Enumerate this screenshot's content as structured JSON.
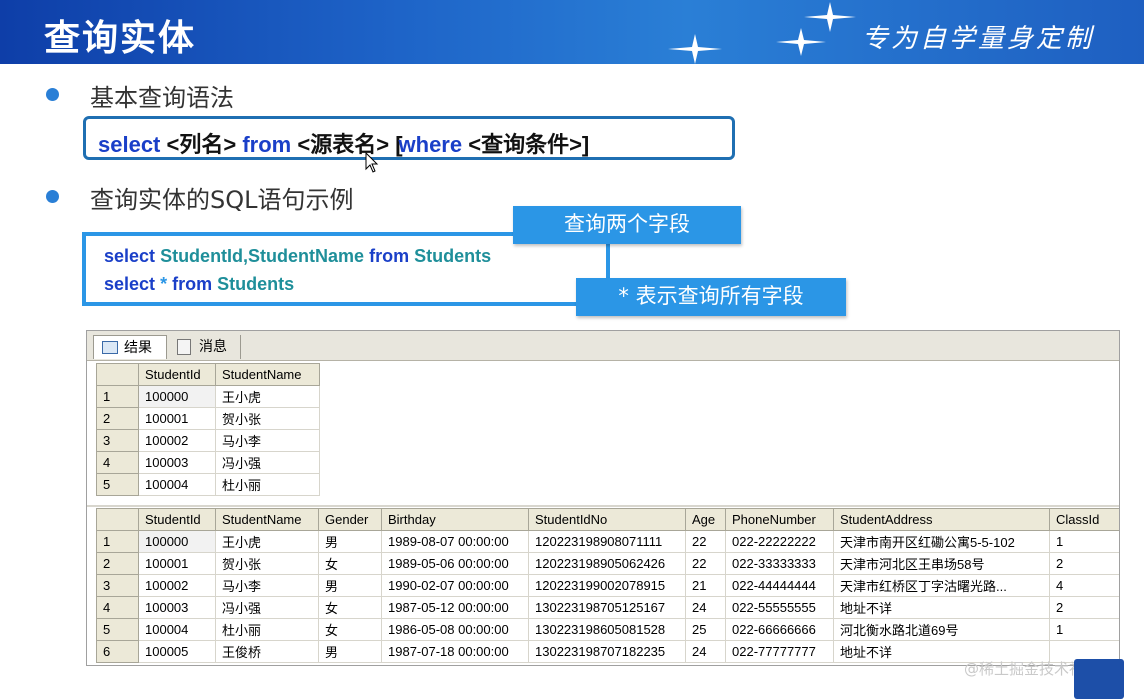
{
  "header": {
    "title": "查询实体",
    "slogan": "专为自学量身定制"
  },
  "bullets": [
    {
      "text": "基本查询语法"
    },
    {
      "text": "查询实体的SQL语句示例"
    }
  ],
  "syntax": {
    "select": "select",
    "col": "<列名>",
    "from": "from",
    "src": "<源表名>",
    "lbr": "[",
    "where": "where",
    "cond": "<查询条件>]"
  },
  "examples": {
    "line1": {
      "select": "select",
      "cols": "StudentId,StudentName",
      "from": "from",
      "table": "Students"
    },
    "line2": {
      "select": "select",
      "star": "*",
      "from": "from",
      "table": "Students"
    },
    "callout1": "查询两个字段",
    "callout2": "* 表示查询所有字段"
  },
  "results_panel": {
    "tabs": [
      {
        "label": "结果",
        "icon": "grid-icon"
      },
      {
        "label": "消息",
        "icon": "message-icon"
      }
    ],
    "grid1": {
      "columns": [
        "StudentId",
        "StudentName"
      ],
      "rows": [
        [
          "1",
          "100000",
          "王小虎"
        ],
        [
          "2",
          "100001",
          "贺小张"
        ],
        [
          "3",
          "100002",
          "马小李"
        ],
        [
          "4",
          "100003",
          "冯小强"
        ],
        [
          "5",
          "100004",
          "杜小丽"
        ]
      ]
    },
    "grid2": {
      "columns": [
        "StudentId",
        "StudentName",
        "Gender",
        "Birthday",
        "StudentIdNo",
        "Age",
        "PhoneNumber",
        "StudentAddress",
        "ClassId"
      ],
      "rows": [
        [
          "1",
          "100000",
          "王小虎",
          "男",
          "1989-08-07 00:00:00",
          "120223198908071111",
          "22",
          "022-22222222",
          "天津市南开区红磡公寓5-5-102",
          "1"
        ],
        [
          "2",
          "100001",
          "贺小张",
          "女",
          "1989-05-06 00:00:00",
          "120223198905062426",
          "22",
          "022-33333333",
          "天津市河北区王串场58号",
          "2"
        ],
        [
          "3",
          "100002",
          "马小李",
          "男",
          "1990-02-07 00:00:00",
          "120223199002078915",
          "21",
          "022-44444444",
          "天津市红桥区丁字沽曙光路...",
          "4"
        ],
        [
          "4",
          "100003",
          "冯小强",
          "女",
          "1987-05-12 00:00:00",
          "130223198705125167",
          "24",
          "022-55555555",
          "地址不详",
          "2"
        ],
        [
          "5",
          "100004",
          "杜小丽",
          "女",
          "1986-05-08 00:00:00",
          "130223198605081528",
          "25",
          "022-66666666",
          "河北衡水路北道69号",
          "1"
        ],
        [
          "6",
          "100005",
          "王俊桥",
          "男",
          "1987-07-18 00:00:00",
          "130223198707182235",
          "24",
          "022-77777777",
          "地址不详",
          ""
        ]
      ]
    }
  },
  "watermark": "@稀土掘金技术社区",
  "colors": {
    "header_blue": "#1e64c8",
    "box_border": "#2b96e6",
    "keyword": "#1a3fc8"
  }
}
